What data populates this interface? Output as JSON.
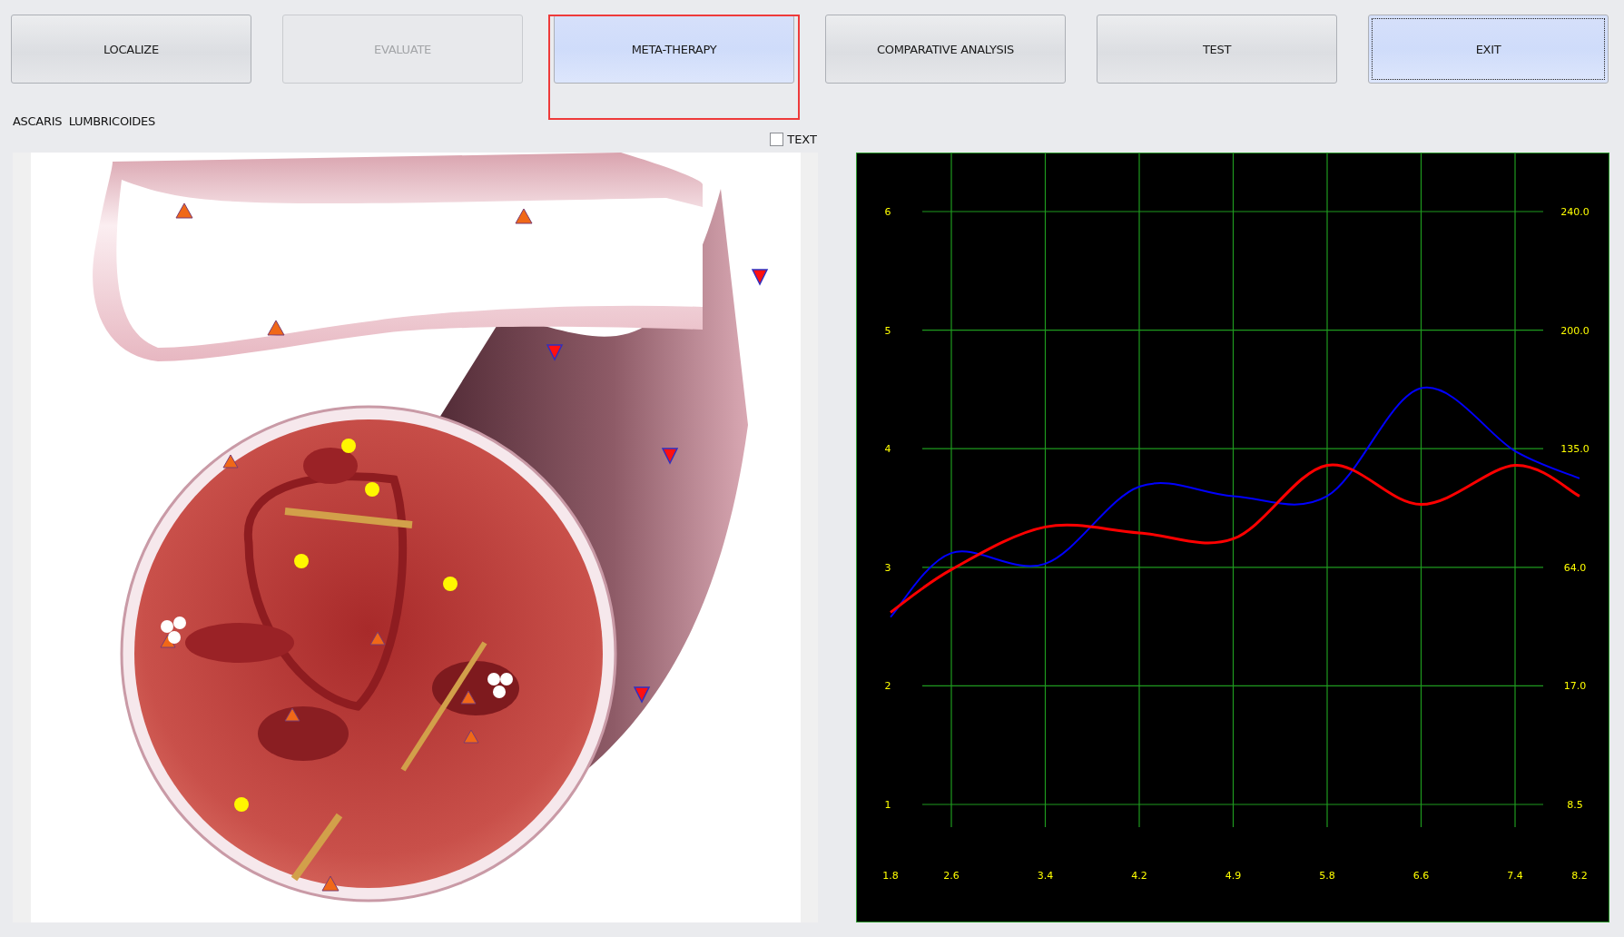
{
  "toolbar": {
    "buttons": [
      {
        "label": "LOCALIZE",
        "disabled": false,
        "active": false,
        "focused": false,
        "highlighted": false
      },
      {
        "label": "EVALUATE",
        "disabled": true,
        "active": false,
        "focused": false,
        "highlighted": false
      },
      {
        "label": "META-THERAPY",
        "disabled": false,
        "active": true,
        "focused": false,
        "highlighted": true
      },
      {
        "label": "COMPARATIVE ANALYSIS",
        "disabled": false,
        "active": false,
        "focused": false,
        "highlighted": false
      },
      {
        "label": "TEST",
        "disabled": false,
        "active": false,
        "focused": false,
        "highlighted": false
      },
      {
        "label": "EXIT",
        "disabled": false,
        "active": true,
        "focused": true,
        "highlighted": false
      }
    ]
  },
  "organism_label": "ASCARIS  LUMBRICOIDES",
  "text_checkbox": {
    "label": "TEXT",
    "checked": false
  },
  "chart": {
    "chart_data": {
      "type": "line",
      "categories": [
        "1.8",
        "2.6",
        "3.4",
        "4.2",
        "4.9",
        "5.8",
        "6.6",
        "7.4",
        "8.2"
      ],
      "yticks": [
        1,
        2,
        3,
        4,
        5,
        6
      ],
      "ylim": [
        1,
        6
      ],
      "grid": true,
      "series": [
        {
          "color": "#0000ff",
          "values": [
            2.58,
            3.12,
            3.03,
            3.68,
            3.6,
            3.6,
            4.51,
            3.98,
            3.75
          ]
        },
        {
          "color": "#ff0000",
          "values": [
            2.62,
            2.98,
            3.34,
            3.29,
            3.24,
            3.86,
            3.53,
            3.86,
            3.6
          ]
        }
      ]
    },
    "right_axis_labels": [
      "240.0",
      "200.0",
      "135.0",
      "64.0",
      "17.0",
      "8.5"
    ]
  }
}
